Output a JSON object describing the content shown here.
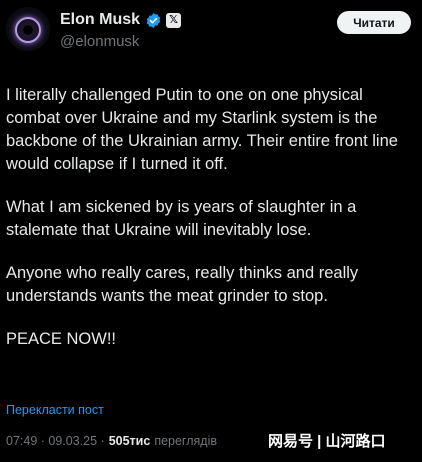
{
  "header": {
    "display_name": "Elon Musk",
    "handle": "@elonmusk",
    "read_button": "Читати",
    "x_badge": "𝕏"
  },
  "tweet": {
    "paragraphs": [
      "I literally challenged Putin to one on one physical combat over Ukraine and my Starlink system is the backbone of the Ukrainian army. Their entire front line would collapse if I turned it off.",
      "What I am sickened by is years of slaughter in a stalemate that Ukraine will inevitably lose.",
      "Anyone who really cares, really thinks and really understands wants the meat grinder to stop.",
      "PEACE NOW!!"
    ],
    "translate_link": "Перекласти пост"
  },
  "meta": {
    "time_date": "07:49 · 09.03.25 ·",
    "views_count": "505тис",
    "views_label": "переглядів"
  },
  "watermark": "网易号 | 山河路口",
  "colors": {
    "background": "#000000",
    "text": "#e7e9ea",
    "secondary": "#71767b",
    "link": "#1d9bf0",
    "verified": "#1d9bf0"
  }
}
